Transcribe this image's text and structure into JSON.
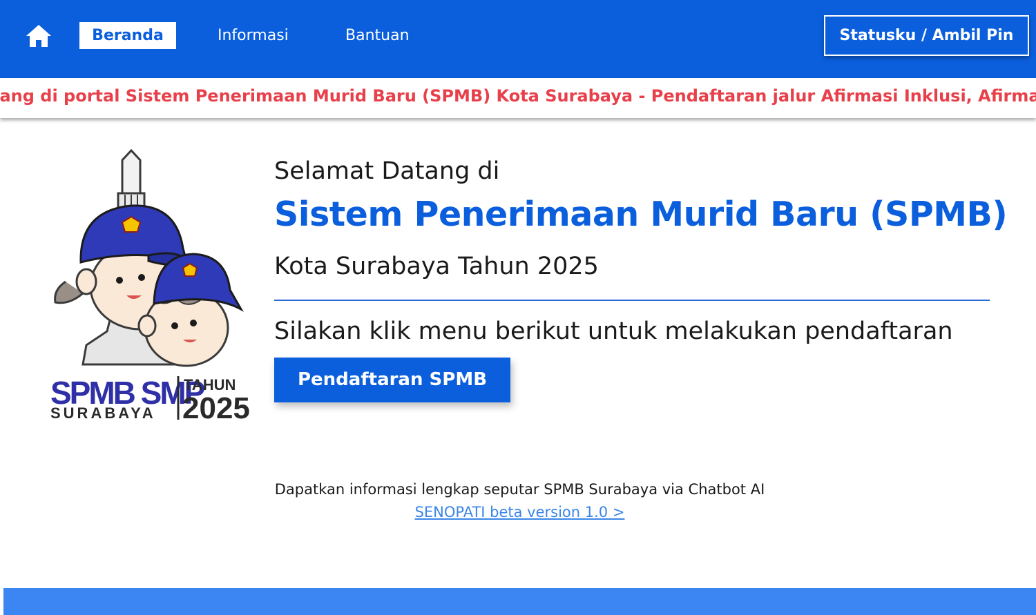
{
  "nav": {
    "home_icon": "home-icon",
    "items": [
      {
        "label": "Beranda",
        "active": true
      },
      {
        "label": "Informasi",
        "active": false
      },
      {
        "label": "Bantuan",
        "active": false
      }
    ],
    "status_button": "Statusku / Ambil Pin"
  },
  "marquee": {
    "text": "tang di portal Sistem Penerimaan Murid Baru (SPMB) Kota Surabaya - Pendaftaran jalur Afirmasi Inklusi, Afirmasi Kategori"
  },
  "logo": {
    "line1": "SPMB SMP",
    "line2": "SURABAYA",
    "year_label": "TAHUN",
    "year": "2025"
  },
  "hero": {
    "welcome": "Selamat Datang di",
    "headline": "Sistem Penerimaan Murid Baru (SPMB)",
    "subhead": "Kota Surabaya Tahun 2025",
    "instruction": "Silakan klik menu berikut untuk melakukan pendaftaran",
    "register_button": "Pendaftaran SPMB"
  },
  "chatbot": {
    "info": "Dapatkan informasi lengkap seputar SPMB Surabaya via Chatbot AI",
    "link": "SENOPATI beta version 1.0 >"
  },
  "colors": {
    "primary": "#0b5fdd",
    "marquee_text": "#e8404a",
    "link": "#3b86e8",
    "footer": "#3b86f2"
  }
}
